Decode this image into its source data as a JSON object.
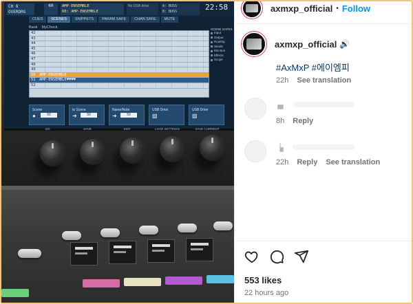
{
  "photo": {
    "screen": {
      "channel": "CH 8",
      "channel_sub": "OVERDRG",
      "scene_number": "60",
      "scene_name": "AMP-ENSEMBLE",
      "scene_name_2": "60: AMP-ENSEMBLE",
      "usb_status": "No USB drive",
      "mini_lines": [
        "A: BUSS",
        "B: BUSS"
      ],
      "clock": "22:58",
      "tabs": [
        "CUES",
        "SCENES",
        "SNIPPETS",
        "PARAM SAFE",
        "CHAN SAFE",
        "MUTE"
      ],
      "active_tab": "SCENES",
      "subtabs": [
        "Bank",
        "MyChock"
      ],
      "rows": [
        {
          "num": "42",
          "name": ""
        },
        {
          "num": "43",
          "name": ""
        },
        {
          "num": "44",
          "name": ""
        },
        {
          "num": "45",
          "name": ""
        },
        {
          "num": "46",
          "name": ""
        },
        {
          "num": "47",
          "name": ""
        },
        {
          "num": "48",
          "name": ""
        },
        {
          "num": "49",
          "name": ""
        },
        {
          "num": "50",
          "name": "AMP-ENSEMBLE"
        },
        {
          "num": "51",
          "name": "AMP-ENSEMBLE♥♥♥♥"
        },
        {
          "num": "52",
          "name": ""
        }
      ],
      "scene_safes_title": "SCENE SAFES",
      "scene_safes": [
        "Input",
        "Output",
        "Routing",
        "Sends",
        "Mix Bus",
        "Effects",
        "Scope"
      ],
      "buttons": [
        {
          "label": "Scene",
          "value": "50",
          "footer": "GO"
        },
        {
          "label": "to Scene",
          "value": "50",
          "footer": "SAVE"
        },
        {
          "label": "Name/Note",
          "value": "50",
          "footer": "EDIT"
        },
        {
          "label": "USB Drive",
          "value": "",
          "footer": "LOAD SETTINGS"
        },
        {
          "label": "USB Drive",
          "value": "",
          "footer": "SAVE CURRENT"
        }
      ]
    }
  },
  "post": {
    "header": {
      "username": "axmxp_official",
      "separator": "•",
      "follow_label": "Follow"
    },
    "caption": {
      "username": "axmxp_official",
      "speaker_glyph": "🔊",
      "text": "#AxMxP #에이엠피",
      "time": "22h",
      "translate": "See translation"
    },
    "comments": [
      {
        "name_glyph": "▗▖",
        "time": "8h",
        "reply": "Reply",
        "translate": ""
      },
      {
        "name_glyph": "▕▖",
        "time": "22h",
        "reply": "Reply",
        "translate": "See translation"
      }
    ],
    "actions": {
      "like_icon": "heart-icon",
      "comment_icon": "comment-icon",
      "share_icon": "share-icon"
    },
    "likes": "553 likes",
    "posted_ago": "22 hours ago"
  },
  "colors": {
    "accent": "#0095f6",
    "text": "#262626",
    "muted": "#737373",
    "hashtag": "#00376b",
    "scene_highlight": "#e8a33a",
    "screen_bg": "#0f2335"
  }
}
